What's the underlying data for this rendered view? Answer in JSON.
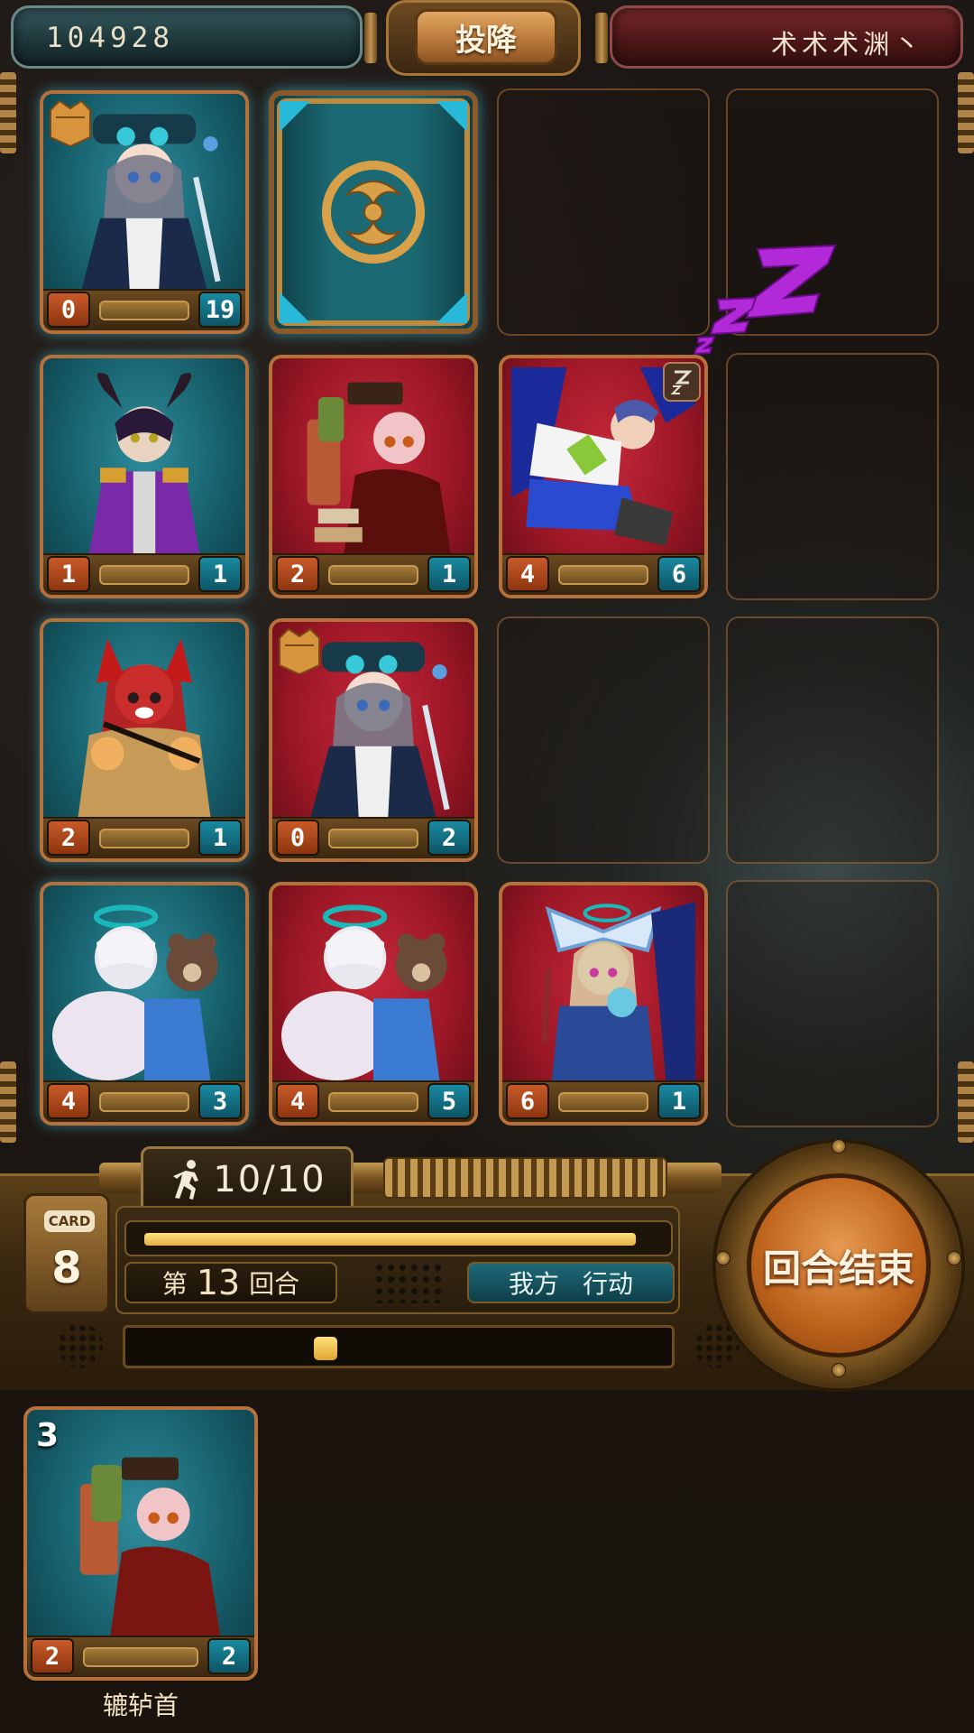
{
  "top_bar": {
    "score": "104928",
    "surrender_label": "投降",
    "opponent_name": "术术术渊丶"
  },
  "board": {
    "rows": [
      [
        {
          "type": "card",
          "color": "blue",
          "atk": "0",
          "hp": "19",
          "crown": true,
          "art": "pirate-girl"
        },
        {
          "type": "card-back"
        },
        {
          "type": "empty"
        },
        {
          "type": "empty"
        }
      ],
      [
        {
          "type": "card",
          "color": "blue",
          "atk": "1",
          "hp": "1",
          "art": "horned-boy"
        },
        {
          "type": "card",
          "color": "red",
          "atk": "2",
          "hp": "1",
          "art": "book-girl"
        },
        {
          "type": "card",
          "color": "red",
          "atk": "4",
          "hp": "6",
          "sleeping": true,
          "art": "acrobat-boy"
        },
        {
          "type": "empty"
        }
      ],
      [
        {
          "type": "card",
          "color": "blue",
          "atk": "2",
          "hp": "1",
          "art": "fox-girl"
        },
        {
          "type": "card",
          "color": "red",
          "atk": "0",
          "hp": "2",
          "crown": true,
          "art": "pirate-girl"
        },
        {
          "type": "empty"
        },
        {
          "type": "empty"
        }
      ],
      [
        {
          "type": "card",
          "color": "blue",
          "atk": "4",
          "hp": "3",
          "art": "sleepy-bear"
        },
        {
          "type": "card",
          "color": "red",
          "atk": "4",
          "hp": "5",
          "art": "sleepy-bear"
        },
        {
          "type": "card",
          "color": "red",
          "atk": "6",
          "hp": "1",
          "art": "bow-girl"
        },
        {
          "type": "empty"
        }
      ]
    ]
  },
  "panel": {
    "actions": "10/10",
    "deck_label": "CARD",
    "deck_count": "8",
    "round_prefix": "第",
    "round_number": "13",
    "round_suffix": "回合",
    "phase_side": "我方",
    "phase_action": "行动",
    "end_turn_label": "回合结束",
    "turn_progress": 0.96,
    "timer_position": 0.36
  },
  "hand": {
    "card": {
      "cost": "3",
      "atk": "2",
      "hp": "2",
      "name": "辘轳首",
      "art": "book-girl"
    }
  },
  "colors": {
    "blue_card": "#17606c",
    "red_card": "#9d1726",
    "frame": "#b6713a",
    "sleep_z": "#b22ad8"
  }
}
